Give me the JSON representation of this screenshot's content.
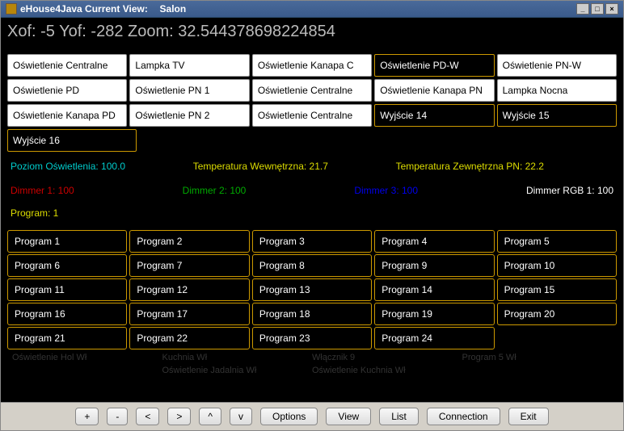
{
  "title_prefix": "eHouse4Java Current View:",
  "title_room": "Salon",
  "coords": "Xof: -5 Yof: -282 Zoom: 32.544378698224854",
  "lights": [
    [
      {
        "label": "Oświetlenie Centralne",
        "dark": false
      },
      {
        "label": "Lampka TV",
        "dark": false
      },
      {
        "label": "Oświetlenie Kanapa C",
        "dark": false
      },
      {
        "label": "Oświetlenie PD-W",
        "dark": true
      },
      {
        "label": "Oświetlenie PN-W",
        "dark": false
      }
    ],
    [
      {
        "label": "Oświetlenie PD",
        "dark": false
      },
      {
        "label": "Oświetlenie PN 1",
        "dark": false
      },
      {
        "label": "Oświetlenie Centralne",
        "dark": false
      },
      {
        "label": "Oświetlenie Kanapa PN",
        "dark": false
      },
      {
        "label": "Lampka Nocna",
        "dark": false
      }
    ],
    [
      {
        "label": "Oświetlenie Kanapa PD",
        "dark": false
      },
      {
        "label": "Oświetlenie PN 2",
        "dark": false
      },
      {
        "label": "Oświetlenie Centralne",
        "dark": false
      },
      {
        "label": "Wyjście 14",
        "dark": true
      },
      {
        "label": "Wyjście 15",
        "dark": true
      }
    ],
    [
      {
        "label": "Wyjście 16",
        "dark": true
      },
      null,
      null,
      null,
      null
    ]
  ],
  "status1": [
    {
      "text": "Poziom Oświetlenia: 100.0",
      "cls": "cyan"
    },
    {
      "text": "Temperatura Wewnętrzna: 21.7",
      "cls": "yellow"
    },
    {
      "text": "Temperatura Zewnętrzna PN: 22.2",
      "cls": "yellow"
    }
  ],
  "status2": [
    {
      "text": "Dimmer 1: 100",
      "cls": "red"
    },
    {
      "text": "Dimmer 2: 100",
      "cls": "green"
    },
    {
      "text": "Dimmer 3: 100",
      "cls": "blue"
    },
    {
      "text": "Dimmer RGB 1: 100",
      "cls": "white"
    }
  ],
  "program_current": "Program: 1",
  "programs": [
    [
      "Program 1",
      "Program 2",
      "Program 3",
      "Program 4",
      "Program 5"
    ],
    [
      "Program 6",
      "Program 7",
      "Program 8",
      "Program 9",
      "Program 10"
    ],
    [
      "Program 11",
      "Program 12",
      "Program 13",
      "Program 14",
      "Program 15"
    ],
    [
      "Program 16",
      "Program 17",
      "Program 18",
      "Program 19",
      "Program 20"
    ],
    [
      "Program 21",
      "Program 22",
      "Program 23",
      "Program 24",
      null
    ]
  ],
  "faded": [
    [
      "Oświetlenie Hol Wł",
      ""
    ],
    [
      "Kuchnia Wł",
      "Oświetlenie Jadalnia Wł"
    ],
    [
      "Włącznik 9",
      "Oświetlenie Kuchnia Wł"
    ],
    [
      "Program 5 Wł",
      ""
    ]
  ],
  "nav": {
    "plus": "+",
    "minus": "-",
    "lt": "<",
    "gt": ">",
    "up": "^",
    "down": "v"
  },
  "buttons": {
    "options": "Options",
    "view": "View",
    "list": "List",
    "connection": "Connection",
    "exit": "Exit"
  }
}
